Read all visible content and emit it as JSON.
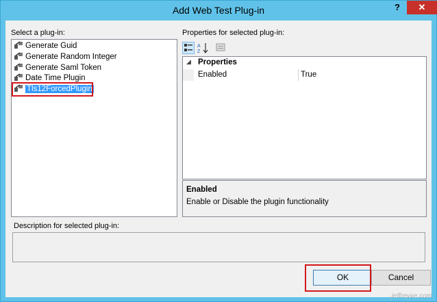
{
  "window": {
    "title": "Add Web Test Plug-in",
    "help_label": "?",
    "close_label": "✕"
  },
  "plugins": {
    "label": "Select a plug-in:",
    "items": [
      {
        "label": "Generate Guid"
      },
      {
        "label": "Generate Random Integer"
      },
      {
        "label": "Generate Saml Token"
      },
      {
        "label": "Date Time Plugin"
      },
      {
        "label": "Tls12ForcedPlugin"
      }
    ],
    "selected_index": 4
  },
  "properties": {
    "label": "Properties for selected plug-in:",
    "category": "Properties",
    "rows": [
      {
        "name": "Enabled",
        "value": "True"
      }
    ],
    "description": {
      "title": "Enabled",
      "text": "Enable or Disable the plugin functionality"
    }
  },
  "description_area": {
    "label": "Description for selected plug-in:"
  },
  "buttons": {
    "ok": "OK",
    "cancel": "Cancel"
  },
  "watermark": "jeffreyxe.com",
  "colors": {
    "title_bar": "#60c2e8",
    "close_button": "#c7312a",
    "selection": "#3399ff",
    "highlight_outline": "#d2161b"
  }
}
